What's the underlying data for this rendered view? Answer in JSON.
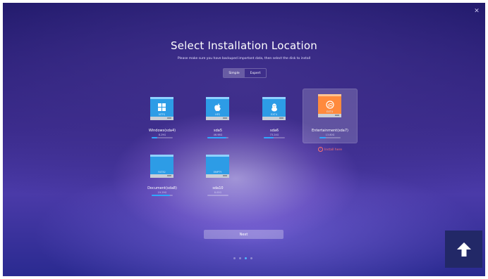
{
  "title": "Select Installation Location",
  "subtitle": "Please make sure you have backuped important data, then select the disk to install",
  "mode_tabs": [
    {
      "label": "Simple",
      "active": true
    },
    {
      "label": "Expert",
      "active": false
    }
  ],
  "disks": [
    {
      "fs": "NTFS",
      "label": "Windows(sda4)",
      "size": "8.29G",
      "usage": 0.25,
      "icon": "windows-icon",
      "selected": false
    },
    {
      "fs": "HFS",
      "label": "sda5",
      "size": "46.98G",
      "usage": 0.9,
      "icon": "apple-icon",
      "selected": false
    },
    {
      "fs": "EXT4",
      "label": "sda6",
      "size": "73.24G",
      "usage": 0.45,
      "icon": "linux-icon",
      "selected": false
    },
    {
      "fs": "EXT4",
      "label": "Entertainment(sda7)",
      "size": "13.80G",
      "usage": 0.3,
      "icon": "deepin-icon",
      "selected": true
    },
    {
      "fs": "FAT32",
      "label": "Document(sda8)",
      "size": "19.29G",
      "usage": 0.85,
      "icon": "",
      "selected": false
    },
    {
      "fs": "EMPTY",
      "label": "sda10",
      "size": "8.00G",
      "usage": 0.0,
      "icon": "",
      "selected": false
    }
  ],
  "install_here_label": "Install here",
  "next_label": "Next",
  "page_dots": {
    "count": 4,
    "active": 2
  },
  "colors": {
    "accent": "#2fa8ff",
    "warning": "#ff7070",
    "drive_blue": "#2d9ce6",
    "drive_orange": "#ff8a3d"
  }
}
